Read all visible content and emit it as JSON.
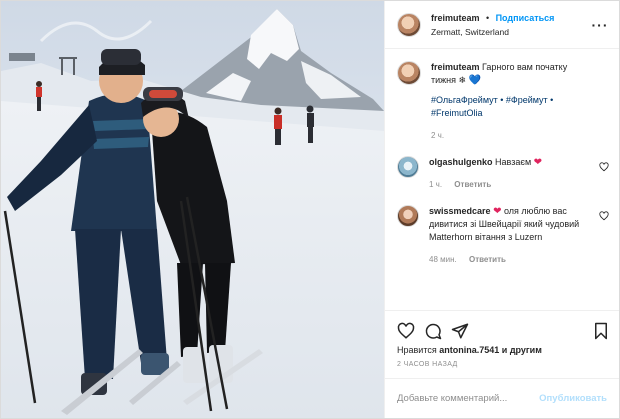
{
  "photo": {
    "alt": "",
    "sky_colors": [
      "#d9e2ee",
      "#f3f5f8"
    ]
  },
  "header": {
    "username": "freimuteam",
    "dot": "•",
    "follow_label": "Подписаться",
    "location": "Zermatt, Switzerland",
    "more_icon": "more-horizontal-icon"
  },
  "caption": {
    "username": "freimuteam",
    "text": "Гарного вам початку тижня ❄",
    "emoji": "💙",
    "tags": "#ОльгаФреймут • #Фреймут • #FreimutOlia",
    "time": "2 ч."
  },
  "comments": [
    {
      "username": "olgashulgenko",
      "text": "Навзаєм",
      "emoji": "❤",
      "time": "1 ч.",
      "reply_label": "Ответить"
    },
    {
      "username": "swissmedcare",
      "emoji": "❤",
      "text": "оля люблю вас дивитися зі Швейцарії який чудовий Matterhorn вітання з Luzern",
      "time": "48 мин.",
      "reply_label": "Ответить"
    }
  ],
  "actions": {
    "likes_prefix": "Нравится",
    "likes_user": "antonina.7541",
    "likes_suffix": "и другим",
    "posted": "2 ЧАСОВ НАЗАД"
  },
  "add_comment": {
    "placeholder": "Добавьте комментарий...",
    "publish_label": "Опубликовать"
  },
  "colors": {
    "link_blue": "#0095f6",
    "hashtag_blue": "#00376b",
    "muted": "#8e8e8e",
    "heart_red": "#e0245e"
  }
}
